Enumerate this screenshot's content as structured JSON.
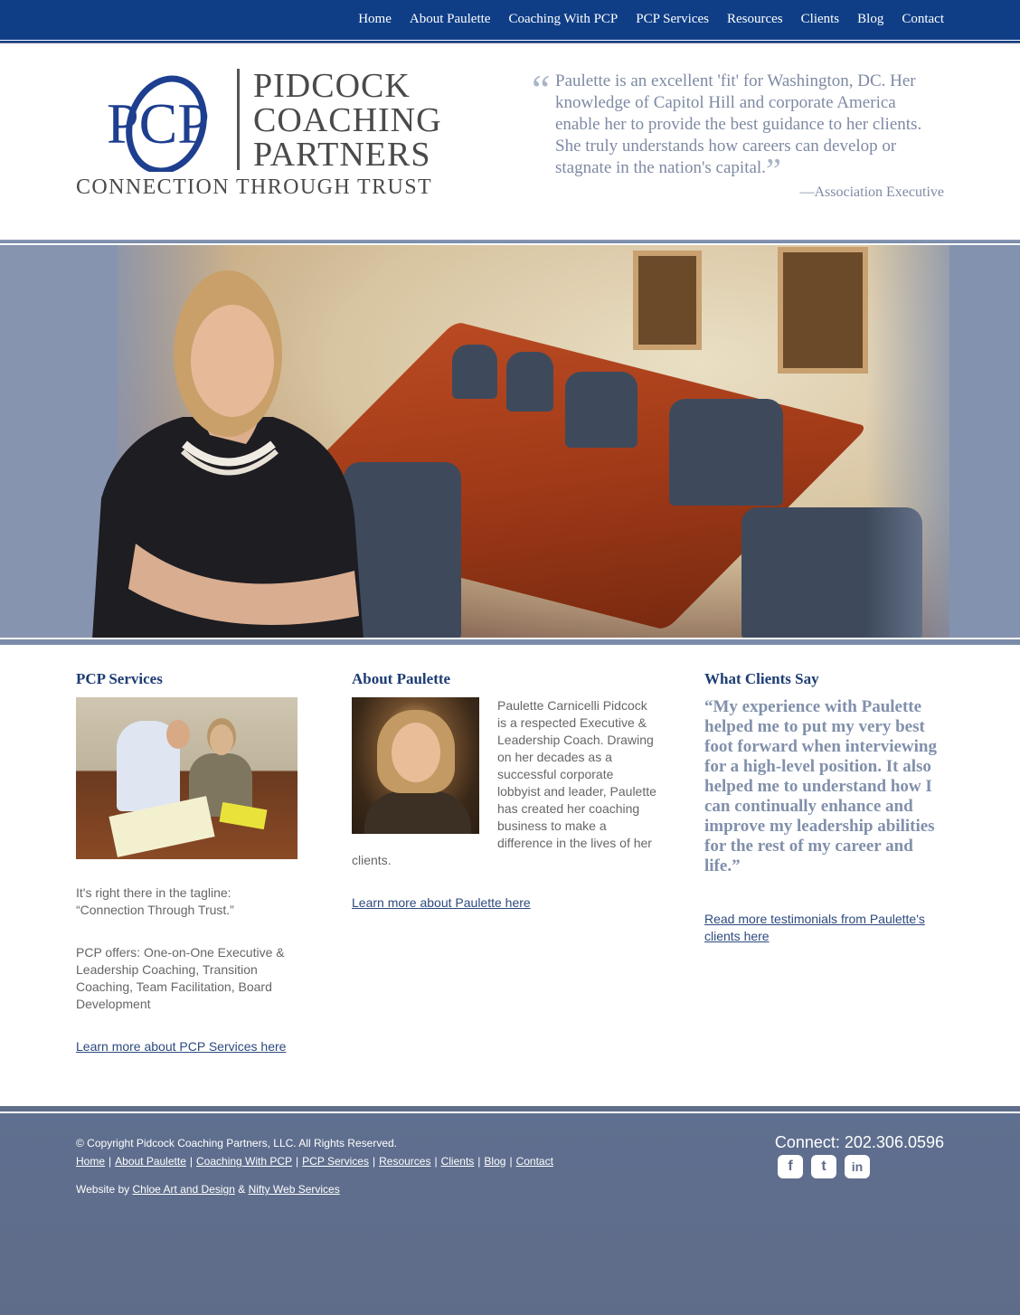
{
  "nav": {
    "items": [
      {
        "label": "Home"
      },
      {
        "label": "About Paulette"
      },
      {
        "label": "Coaching With PCP"
      },
      {
        "label": "PCP Services"
      },
      {
        "label": "Resources"
      },
      {
        "label": "Clients"
      },
      {
        "label": "Blog"
      },
      {
        "label": "Contact"
      }
    ]
  },
  "logo": {
    "monogram": "PCP",
    "line1": "PIDCOCK",
    "line2": "COACHING",
    "line3": "PARTNERS",
    "tagline": "CONNECTION THROUGH TRUST",
    "brand_blue": "#1e3f8f"
  },
  "header_quote": {
    "text": "Paulette is an excellent 'fit' for Washington, DC. Her knowledge of Capitol Hill and corporate America enable her to provide the best guidance to her clients. She truly understands how careers can develop or stagnate in the nation's capital.",
    "attribution": "—Association Executive"
  },
  "services": {
    "heading": "PCP Services",
    "p1": "It's right there in the tagline: “Connection Through Trust.”",
    "p2": "PCP offers: One-on-One Executive & Leadership Coaching, Transition Coaching, Team Facilitation, Board Development",
    "link": "Learn more about PCP Services here"
  },
  "about": {
    "heading": "About Paulette",
    "p1": "Paulette Carnicelli Pidcock is a respected Executive & Leadership Coach. Drawing on her decades as a successful corporate lobbyist and leader, Paulette has created her coaching business to make a difference in the lives of her clients.",
    "link": "Learn more about Paulette here"
  },
  "clients": {
    "heading": "What Clients Say",
    "quote": "“My experience with Paulette helped me to put my very best foot forward when interviewing for a high-level position. It also helped me to understand how I can continually enhance and improve my leadership abilities for the rest of my career and life.”",
    "link": "Read more testimonials from Paulette's clients here"
  },
  "footer": {
    "copyright": "© Copyright Pidcock Coaching Partners, LLC. All Rights Reserved.",
    "links": [
      {
        "label": "Home"
      },
      {
        "label": "About Paulette"
      },
      {
        "label": "Coaching With PCP"
      },
      {
        "label": "PCP Services"
      },
      {
        "label": "Resources"
      },
      {
        "label": "Clients"
      },
      {
        "label": "Blog"
      },
      {
        "label": "Contact"
      }
    ],
    "separator": "|",
    "credit_prefix": "Website by",
    "credit_link1": "Chloe Art and Design",
    "credit_amp": "&",
    "credit_link2": "Nifty Web Services",
    "connect": "Connect: 202.306.0596",
    "social": [
      {
        "icon": "facebook-icon",
        "glyph": "f"
      },
      {
        "icon": "twitter-icon",
        "glyph": "t"
      },
      {
        "icon": "linkedin-icon",
        "glyph": "in"
      }
    ]
  },
  "colors": {
    "nav_bg": "#0f3e87",
    "heading_blue": "#1d3c73",
    "quote_gray_blue": "#7e8aa3",
    "footer_bg": "#5f6d8a"
  }
}
